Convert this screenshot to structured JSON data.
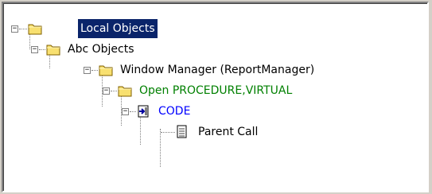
{
  "tree": {
    "nodes": [
      {
        "label": "Local Objects",
        "icon": "folder-icon",
        "expander": "−",
        "color": "#ffffff",
        "selected": true
      },
      {
        "label": "Abc Objects",
        "icon": "folder-icon",
        "expander": "−",
        "color": "#000000"
      },
      {
        "label": "Window Manager (ReportManager)",
        "icon": "folder-icon",
        "expander": "−",
        "color": "#000000"
      },
      {
        "label": "Open PROCEDURE,VIRTUAL",
        "icon": "folder-icon",
        "expander": "−",
        "color": "#008000"
      },
      {
        "label": "CODE",
        "icon": "code-entry-icon",
        "expander": "−",
        "color": "#0000ff"
      },
      {
        "label": "Parent Call",
        "icon": "document-icon",
        "color": "#000000"
      }
    ]
  }
}
